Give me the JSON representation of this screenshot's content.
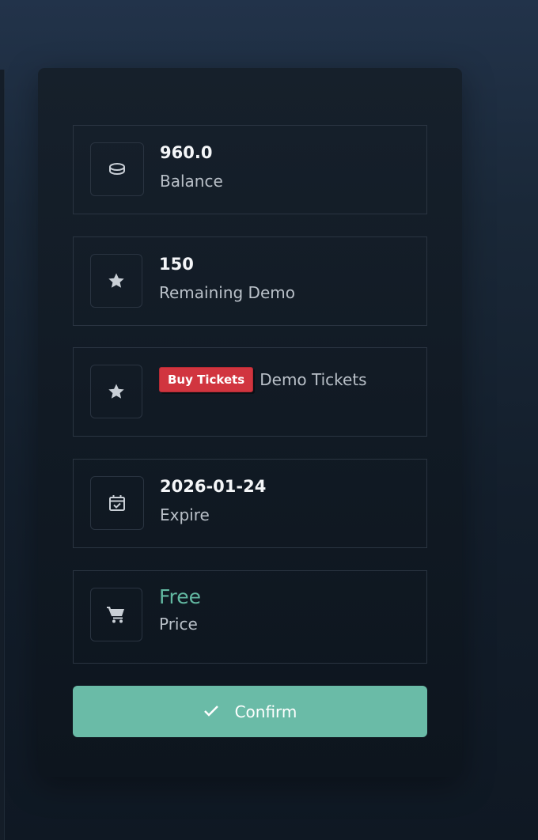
{
  "stats": {
    "balance": {
      "value": "960.0",
      "label": "Balance",
      "icon": "coins-icon"
    },
    "remaining": {
      "value": "150",
      "label": "Remaining Demo",
      "icon": "star-icon"
    },
    "tickets": {
      "badge": "Buy Tickets",
      "label": "Demo Tickets",
      "icon": "star-icon"
    },
    "expire": {
      "value": "2026-01-24",
      "label": "Expire",
      "icon": "calendar-check-icon"
    },
    "price": {
      "value": "Free",
      "label": "Price",
      "icon": "cart-icon"
    }
  },
  "confirm": {
    "label": "Confirm",
    "icon": "check-icon"
  },
  "colors": {
    "accent": "#6abba7",
    "free_text": "#62b8a1",
    "badge": "#d1353f"
  }
}
